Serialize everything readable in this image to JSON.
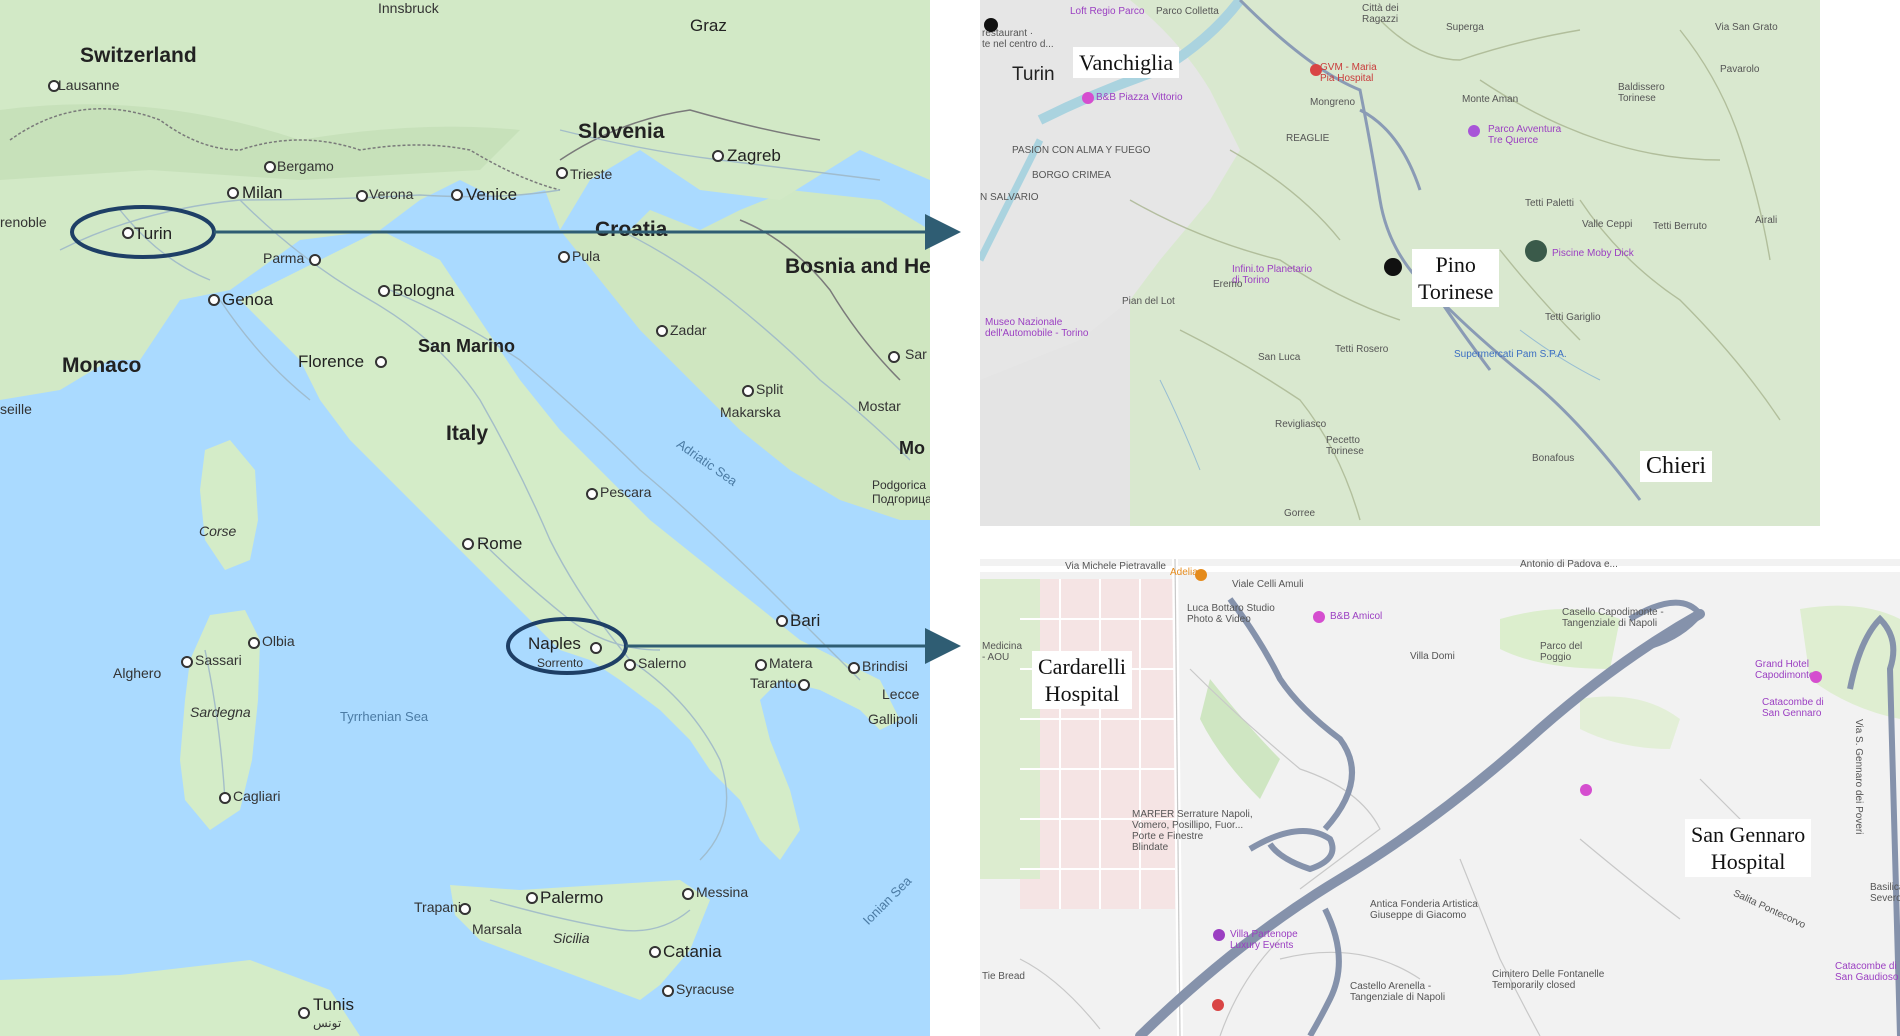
{
  "italy_map": {
    "countries": [
      "Switzerland",
      "Slovenia",
      "Croatia",
      "Bosnia and Herzegovina",
      "Monaco",
      "San Marino",
      "Italy"
    ],
    "cities": {
      "innsbruck": "Innsbruck",
      "graz": "Graz",
      "lausanne": "Lausanne",
      "grenoble": "renoble",
      "bergamo": "Bergamo",
      "milan": "Milan",
      "verona": "Verona",
      "venice": "Venice",
      "trieste": "Trieste",
      "zagreb": "Zagreb",
      "turin": "Turin",
      "parma": "Parma",
      "pula": "Pula",
      "genoa": "Genoa",
      "bologna": "Bologna",
      "zadar": "Zadar",
      "sarajevo": "Sar",
      "florence": "Florence",
      "marseille": "seille",
      "split": "Split",
      "mostar": "Mostar",
      "makarska": "Makarska",
      "montenegro": "Mo",
      "podgorica": "Podgorica",
      "podgorica_cyr": "Подгорица",
      "pescara": "Pescara",
      "rome": "Rome",
      "bari": "Bari",
      "naples": "Naples",
      "sorrento": "Sorrento",
      "salerno": "Salerno",
      "matera": "Matera",
      "brindisi": "Brindisi",
      "taranto": "Taranto",
      "lecce": "Lecce",
      "gallipoli": "Gallipoli",
      "olbia": "Olbia",
      "sassari": "Sassari",
      "alghero": "Alghero",
      "cagliari": "Cagliari",
      "palermo": "Palermo",
      "trapani": "Trapani",
      "marsala": "Marsala",
      "messina": "Messina",
      "catania": "Catania",
      "syracuse": "Syracuse",
      "tunis": "Tunis",
      "tunis_ar": "تونس"
    },
    "islands": [
      "Corse",
      "Sardegna",
      "Sicilia"
    ],
    "seas": [
      "Adriatic Sea",
      "Tyrrhenian Sea",
      "Ionian Sea"
    ]
  },
  "turin_map": {
    "callouts": [
      "Vanchiglia",
      "Pino\nTorinese",
      "Chieri"
    ],
    "labels": {
      "turin": "Turin",
      "citta": "Città dei\nRagazzi",
      "superga": "Superga",
      "via_san_grato": "Via San Grato",
      "pavarolo": "Pavarolo",
      "mongreno": "Mongreno",
      "gvm": "GVM - Maria\nPia Hospital",
      "monte_aman": "Monte Aman",
      "baldissero": "Baldissero\nTorinese",
      "parco_avventura": "Parco Avventura\nTre Querce",
      "reaglie": "REAGLIE",
      "pasion": "PASION CON ALMA Y FUEGO",
      "borgo_crimea": "BORGO CRIMEA",
      "san_salvario": "N SALVARIO",
      "tetti_paletti": "Tetti Paletti",
      "valle_ceppi": "Valle Ceppi",
      "tetti_berruto": "Tetti Berruto",
      "airali": "Airali",
      "piscine": "Piscine Moby Dick",
      "infini": "Infini.to Planetario\ndi Torino",
      "eremo": "Eremo",
      "pian_del_lot": "Pian del Lot",
      "museo": "Museo Nazionale\ndell'Automobile - Torino",
      "tetti_gariglio": "Tetti Gariglio",
      "san_luca": "San Luca",
      "tetti_rosero": "Tetti Rosero",
      "supermercati": "Supermercati Pam S.P.A.",
      "revigliasco": "Revigliasco",
      "pecetto": "Pecetto\nTorinese",
      "bonafous": "Bonafous",
      "gorree": "Gorree",
      "loft": "Loft Regio Parco",
      "parco_colletta": "Parco Colletta",
      "bb_piazza": "B&B Piazza Vittorio",
      "restaurant": "restaurant ·\nte nel centro d..."
    }
  },
  "naples_map": {
    "callouts": [
      "Cardarelli\nHospital",
      "San Gennaro\nHospital"
    ],
    "labels": {
      "via_pietravalle": "Via Michele Pietravalle",
      "via_celli": "Viale Celli Amuli",
      "antonio": "Antonio di Padova e...",
      "adelia": "Adelia",
      "luca_bottaro": "Luca Bottaro Studio\nPhoto & Video",
      "bb_amicol": "B&B Amicol",
      "capodimonte": "Casello Capodimonte -\nTangenziale di Napoli",
      "parco_poggio": "Parco del\nPoggio",
      "villa_domi": "Villa Domi",
      "grand_hotel": "Grand Hotel\nCapodimonte",
      "catacombe_gennaro": "Catacombe di\nSan Gennaro",
      "medicina": "Medicina\n- AOU",
      "marfer": "MARFER Serrature Napoli,\nVomero, Posillipo, Fuor...\nPorte e Finestre\nBlindate",
      "antica": "Antica Fonderia Artistica\nGiuseppe di Giacomo",
      "villa_partenope": "Villa Partenope\nLuxury Events",
      "cimitero": "Cimitero Delle Fontanelle\nTemporarily closed",
      "catacombe_gaudioso": "Catacombe di\nSan Gaudioso",
      "basilica": "Basilica\nSevero Fuori le",
      "castello": "Castello Arenella -\nTangenziale di Napoli",
      "tie_bread": "Tie Bread",
      "via_s_gennaro": "Via S. Gennaro dei Poveri",
      "salita": "Salita Pontecorvo"
    }
  },
  "colors": {
    "sea": "#aadaff",
    "land": "#cfe8c4",
    "arrow": "#2f5d73",
    "ellipse": "#1e3f66"
  }
}
